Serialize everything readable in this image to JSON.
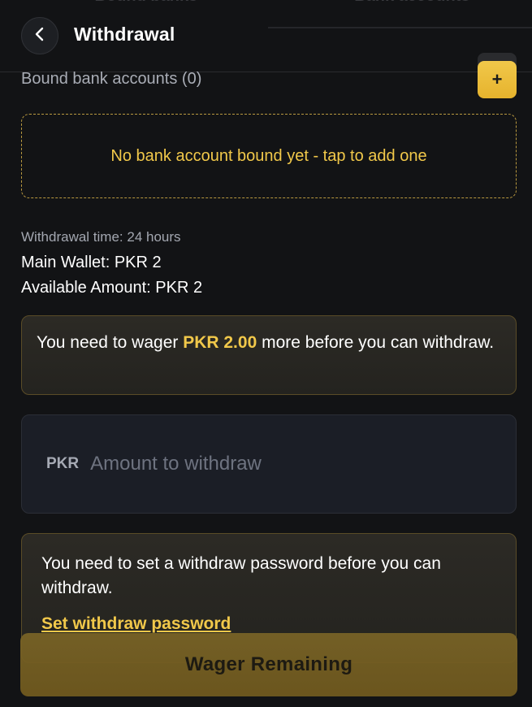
{
  "ghost_tabs": [
    "Bound banks",
    "Bank accounts"
  ],
  "header": {
    "back_icon": "chevron-left-icon",
    "title": "Withdrawal"
  },
  "bound": {
    "label": "Bound bank accounts (0)",
    "add_label": "+",
    "empty_message": "No bank account bound yet - tap to add one"
  },
  "info": {
    "withdrawal_time": "Withdrawal time: 24 hours",
    "main_wallet": "Main Wallet: PKR 2",
    "available_amount": "Available Amount: PKR 2"
  },
  "wager_notice": {
    "prefix": "You need to wager ",
    "amount": "PKR 2.00",
    "suffix": " more before you can withdraw."
  },
  "amount_field": {
    "currency": "PKR",
    "placeholder": "Amount to withdraw",
    "value": ""
  },
  "password_notice": {
    "message": "You need to set a withdraw password before you can withdraw.",
    "link_label": "Set withdraw password"
  },
  "submit": {
    "label": "Wager Remaining"
  },
  "colors": {
    "accent": "#f1c84a",
    "background": "#121315",
    "panel": "#1b1e26"
  }
}
